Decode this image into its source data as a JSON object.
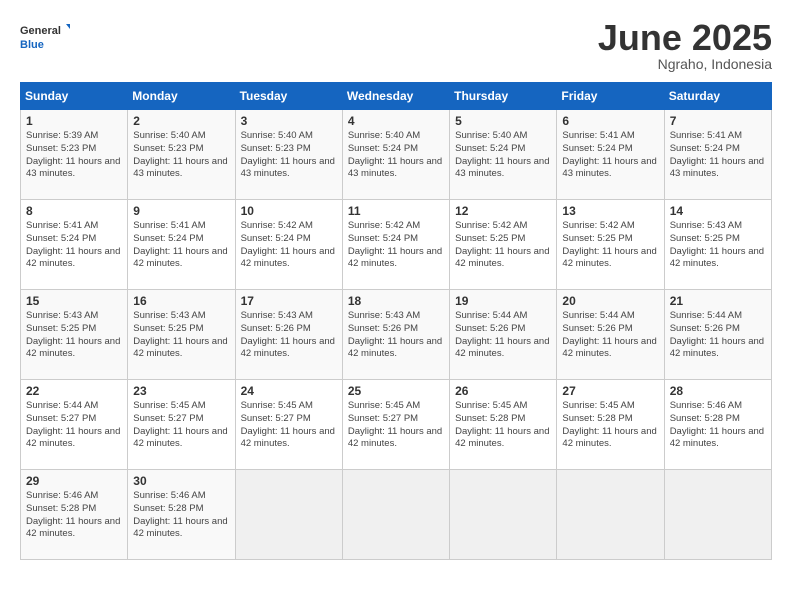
{
  "header": {
    "logo_general": "General",
    "logo_blue": "Blue",
    "month_title": "June 2025",
    "location": "Ngraho, Indonesia"
  },
  "weekdays": [
    "Sunday",
    "Monday",
    "Tuesday",
    "Wednesday",
    "Thursday",
    "Friday",
    "Saturday"
  ],
  "weeks": [
    [
      {
        "day": "1",
        "sunrise": "5:39 AM",
        "sunset": "5:23 PM",
        "daylight": "11 hours and 43 minutes."
      },
      {
        "day": "2",
        "sunrise": "5:40 AM",
        "sunset": "5:23 PM",
        "daylight": "11 hours and 43 minutes."
      },
      {
        "day": "3",
        "sunrise": "5:40 AM",
        "sunset": "5:23 PM",
        "daylight": "11 hours and 43 minutes."
      },
      {
        "day": "4",
        "sunrise": "5:40 AM",
        "sunset": "5:24 PM",
        "daylight": "11 hours and 43 minutes."
      },
      {
        "day": "5",
        "sunrise": "5:40 AM",
        "sunset": "5:24 PM",
        "daylight": "11 hours and 43 minutes."
      },
      {
        "day": "6",
        "sunrise": "5:41 AM",
        "sunset": "5:24 PM",
        "daylight": "11 hours and 43 minutes."
      },
      {
        "day": "7",
        "sunrise": "5:41 AM",
        "sunset": "5:24 PM",
        "daylight": "11 hours and 43 minutes."
      }
    ],
    [
      {
        "day": "8",
        "sunrise": "5:41 AM",
        "sunset": "5:24 PM",
        "daylight": "11 hours and 42 minutes."
      },
      {
        "day": "9",
        "sunrise": "5:41 AM",
        "sunset": "5:24 PM",
        "daylight": "11 hours and 42 minutes."
      },
      {
        "day": "10",
        "sunrise": "5:42 AM",
        "sunset": "5:24 PM",
        "daylight": "11 hours and 42 minutes."
      },
      {
        "day": "11",
        "sunrise": "5:42 AM",
        "sunset": "5:24 PM",
        "daylight": "11 hours and 42 minutes."
      },
      {
        "day": "12",
        "sunrise": "5:42 AM",
        "sunset": "5:25 PM",
        "daylight": "11 hours and 42 minutes."
      },
      {
        "day": "13",
        "sunrise": "5:42 AM",
        "sunset": "5:25 PM",
        "daylight": "11 hours and 42 minutes."
      },
      {
        "day": "14",
        "sunrise": "5:43 AM",
        "sunset": "5:25 PM",
        "daylight": "11 hours and 42 minutes."
      }
    ],
    [
      {
        "day": "15",
        "sunrise": "5:43 AM",
        "sunset": "5:25 PM",
        "daylight": "11 hours and 42 minutes."
      },
      {
        "day": "16",
        "sunrise": "5:43 AM",
        "sunset": "5:25 PM",
        "daylight": "11 hours and 42 minutes."
      },
      {
        "day": "17",
        "sunrise": "5:43 AM",
        "sunset": "5:26 PM",
        "daylight": "11 hours and 42 minutes."
      },
      {
        "day": "18",
        "sunrise": "5:43 AM",
        "sunset": "5:26 PM",
        "daylight": "11 hours and 42 minutes."
      },
      {
        "day": "19",
        "sunrise": "5:44 AM",
        "sunset": "5:26 PM",
        "daylight": "11 hours and 42 minutes."
      },
      {
        "day": "20",
        "sunrise": "5:44 AM",
        "sunset": "5:26 PM",
        "daylight": "11 hours and 42 minutes."
      },
      {
        "day": "21",
        "sunrise": "5:44 AM",
        "sunset": "5:26 PM",
        "daylight": "11 hours and 42 minutes."
      }
    ],
    [
      {
        "day": "22",
        "sunrise": "5:44 AM",
        "sunset": "5:27 PM",
        "daylight": "11 hours and 42 minutes."
      },
      {
        "day": "23",
        "sunrise": "5:45 AM",
        "sunset": "5:27 PM",
        "daylight": "11 hours and 42 minutes."
      },
      {
        "day": "24",
        "sunrise": "5:45 AM",
        "sunset": "5:27 PM",
        "daylight": "11 hours and 42 minutes."
      },
      {
        "day": "25",
        "sunrise": "5:45 AM",
        "sunset": "5:27 PM",
        "daylight": "11 hours and 42 minutes."
      },
      {
        "day": "26",
        "sunrise": "5:45 AM",
        "sunset": "5:28 PM",
        "daylight": "11 hours and 42 minutes."
      },
      {
        "day": "27",
        "sunrise": "5:45 AM",
        "sunset": "5:28 PM",
        "daylight": "11 hours and 42 minutes."
      },
      {
        "day": "28",
        "sunrise": "5:46 AM",
        "sunset": "5:28 PM",
        "daylight": "11 hours and 42 minutes."
      }
    ],
    [
      {
        "day": "29",
        "sunrise": "5:46 AM",
        "sunset": "5:28 PM",
        "daylight": "11 hours and 42 minutes."
      },
      {
        "day": "30",
        "sunrise": "5:46 AM",
        "sunset": "5:28 PM",
        "daylight": "11 hours and 42 minutes."
      },
      null,
      null,
      null,
      null,
      null
    ]
  ]
}
